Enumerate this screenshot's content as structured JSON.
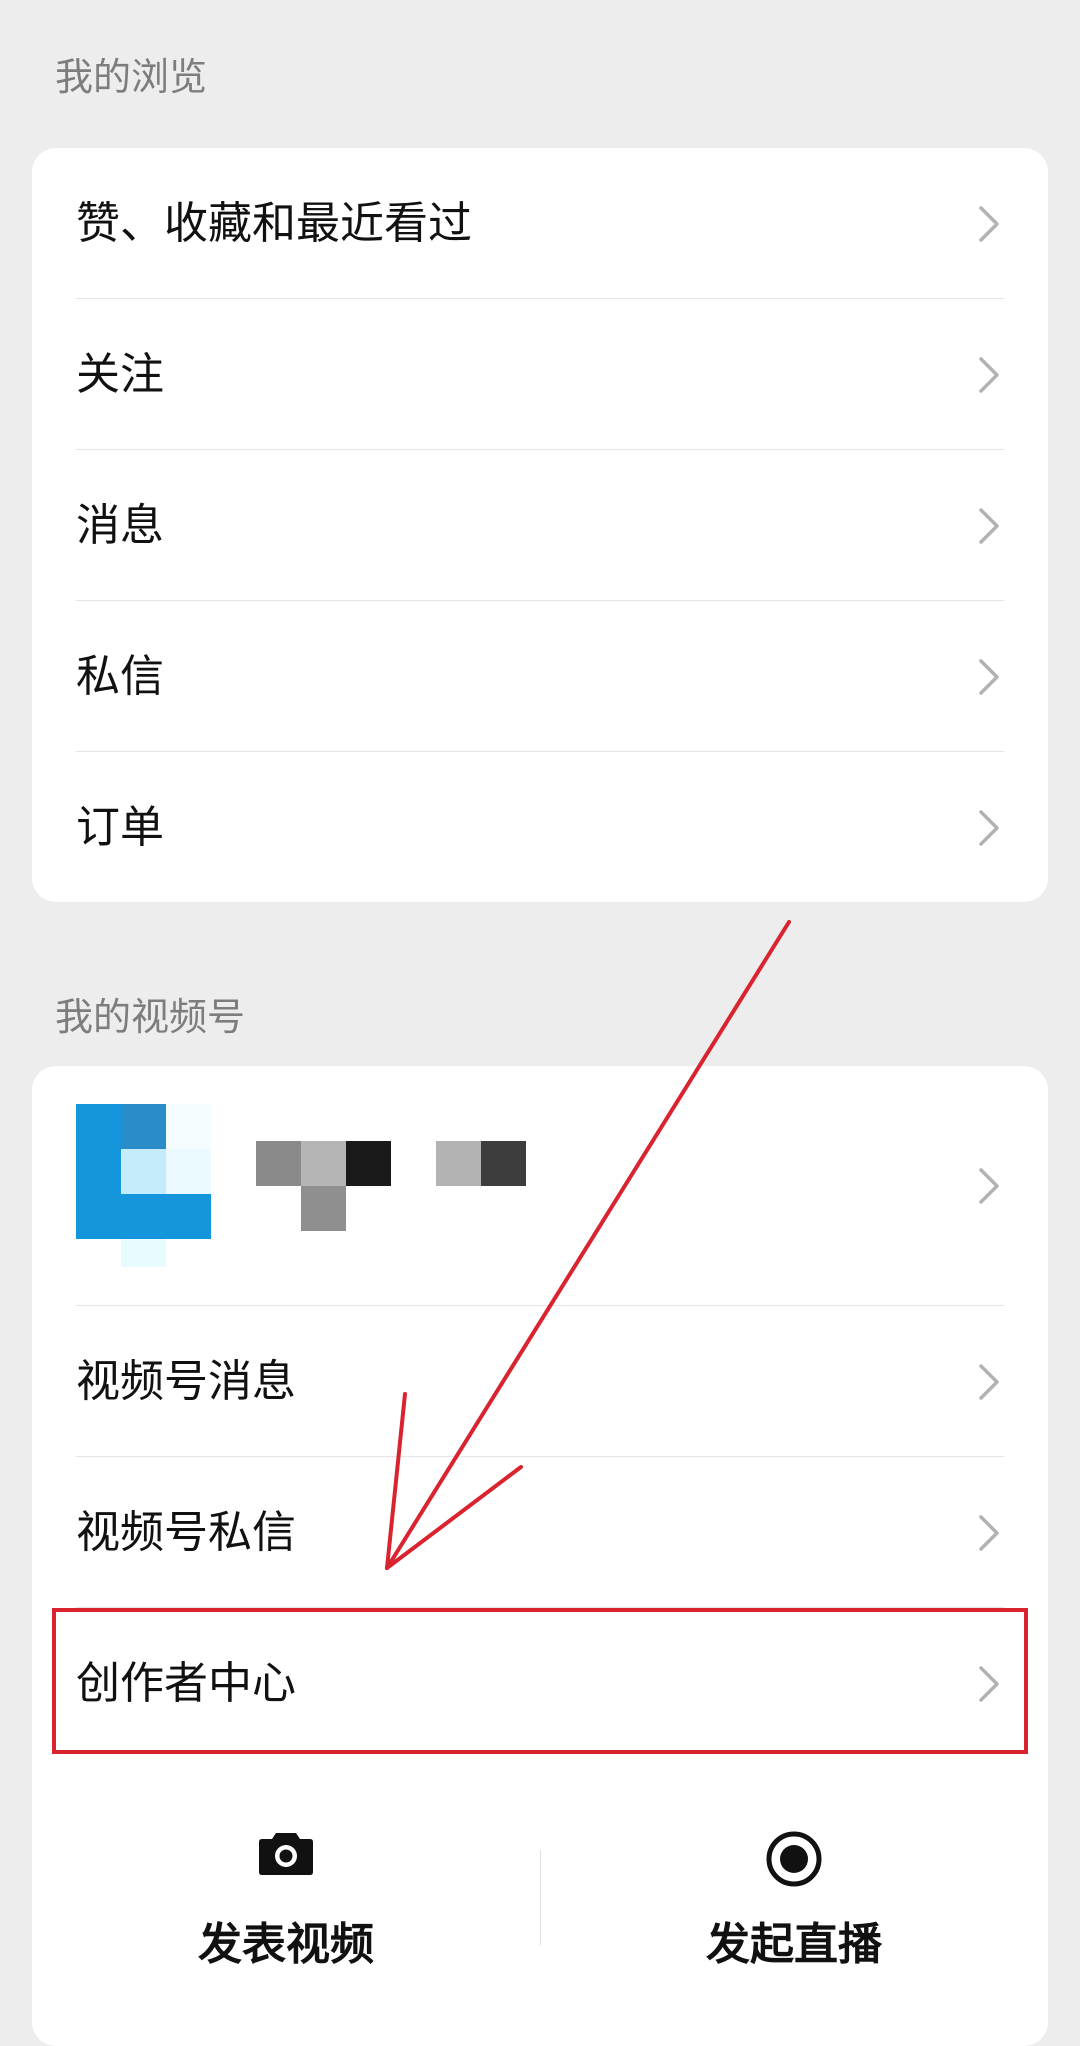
{
  "browsing": {
    "title": "我的浏览",
    "items": [
      {
        "label": "赞、收藏和最近看过"
      },
      {
        "label": "关注"
      },
      {
        "label": "消息"
      },
      {
        "label": "私信"
      },
      {
        "label": "订单"
      }
    ]
  },
  "channels": {
    "title": "我的视频号",
    "items": [
      {
        "label": "视频号消息"
      },
      {
        "label": "视频号私信"
      },
      {
        "label": "创作者中心"
      }
    ]
  },
  "actions": {
    "post_video": "发表视频",
    "go_live": "发起直播"
  },
  "colors": {
    "annotation": "#d9232e",
    "background": "#ededed",
    "card": "#ffffff",
    "section_title": "#7d7d7d"
  },
  "icons": {
    "chevron": "chevron-right-icon",
    "camera": "camera-icon",
    "live": "live-record-icon"
  }
}
